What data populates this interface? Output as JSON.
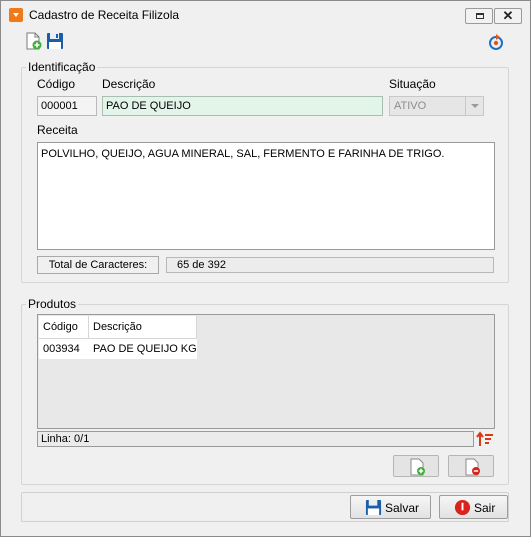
{
  "window": {
    "title": "Cadastro de Receita Filizola",
    "restore_icon": "restore-icon",
    "close_glyph": "✕"
  },
  "toolbar": {
    "new_icon": "new-document-icon",
    "save_icon": "floppy-disk-icon",
    "refresh_icon": "refresh-icon"
  },
  "identificacao": {
    "caption": "Identificação",
    "codigo_label": "Código",
    "codigo_value": "000001",
    "descricao_label": "Descrição",
    "descricao_value": "PAO DE QUEIJO",
    "situacao_label": "Situação",
    "situacao_value": "ATIVO",
    "receita_label": "Receita",
    "receita_value": "POLVILHO, QUEIJO, AGUA MINERAL, SAL, FERMENTO E FARINHA DE TRIGO.",
    "total_label": "Total de Caracteres:",
    "total_value": "65 de 392"
  },
  "produtos": {
    "caption": "Produtos",
    "columns": [
      "Código",
      "Descrição"
    ],
    "rows": [
      {
        "codigo": "003934",
        "descricao": "PAO DE QUEIJO KG"
      }
    ],
    "status": "Linha: 0/1"
  },
  "footer": {
    "save_label": "Salvar",
    "exit_label": "Sair"
  },
  "colors": {
    "accent_orange": "#f07a1a",
    "desc_field_bg": "#e3f5ea",
    "exit_red": "#d9231c",
    "save_blue": "#1b5ea8"
  }
}
